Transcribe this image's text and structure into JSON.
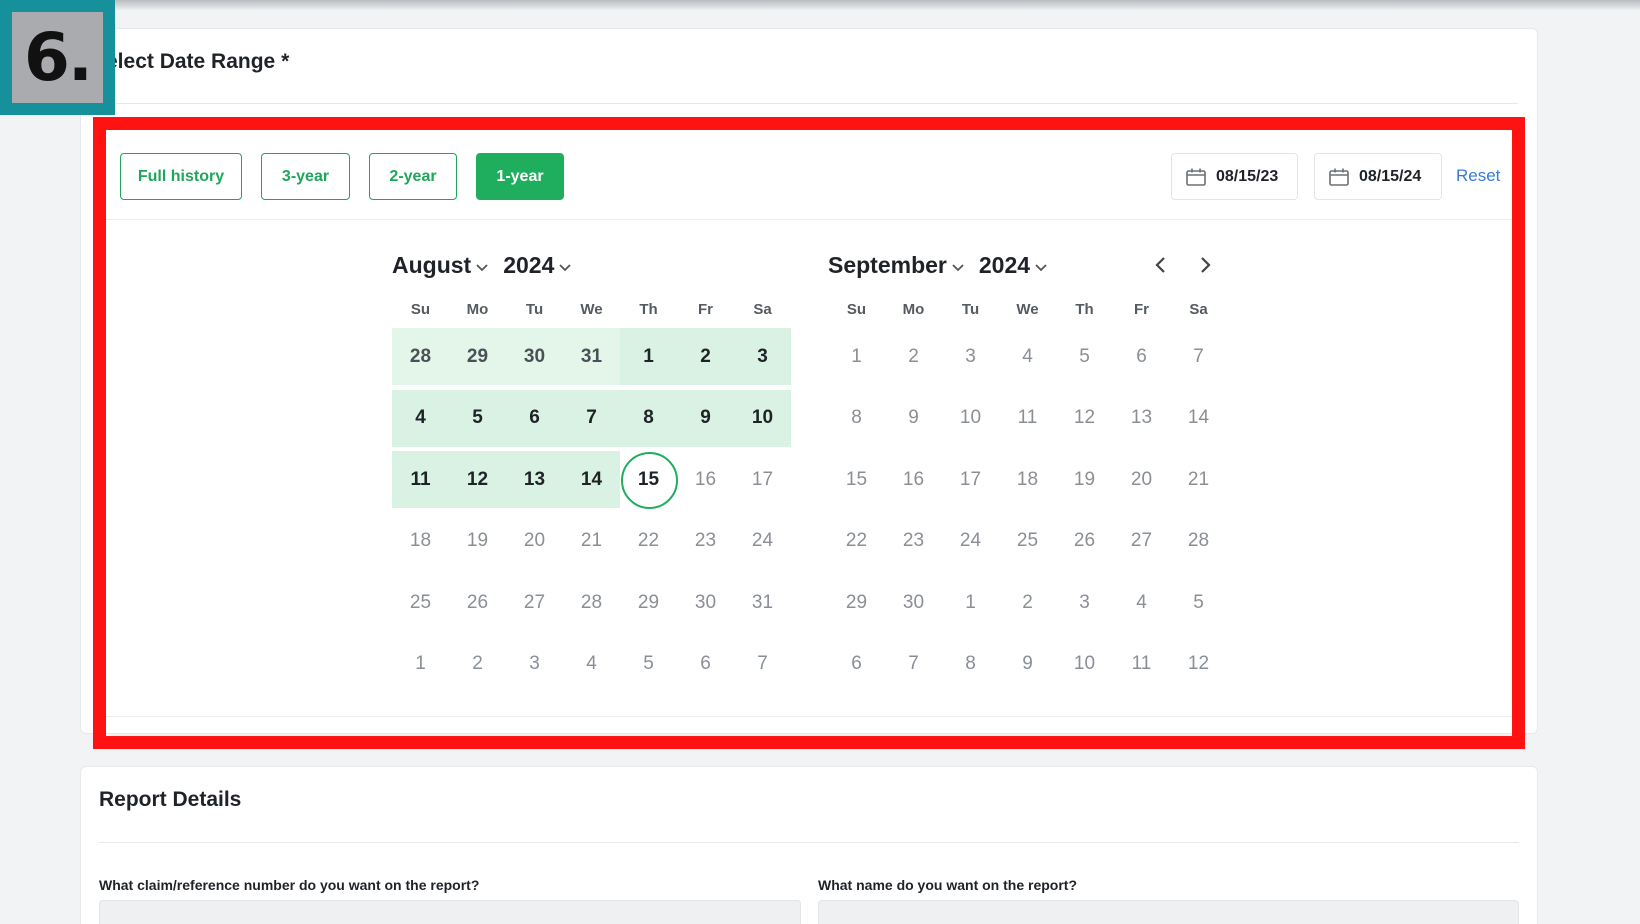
{
  "step_badge": "6.",
  "date_section": {
    "title": "elect Date Range *"
  },
  "range_buttons": [
    {
      "label": "Full history",
      "active": false
    },
    {
      "label": "3-year",
      "active": false
    },
    {
      "label": "2-year",
      "active": false
    },
    {
      "label": "1-year",
      "active": true
    }
  ],
  "start_date": "08/15/23",
  "end_date": "08/15/24",
  "reset_label": "Reset",
  "weekdays": [
    "Su",
    "Mo",
    "Tu",
    "We",
    "Th",
    "Fr",
    "Sa"
  ],
  "calendars": [
    {
      "month": "August",
      "year": "2024",
      "weeks": [
        [
          "28",
          "29",
          "30",
          "31",
          "1",
          "2",
          "3"
        ],
        [
          "4",
          "5",
          "6",
          "7",
          "8",
          "9",
          "10"
        ],
        [
          "11",
          "12",
          "13",
          "14",
          "15",
          "16",
          "17"
        ],
        [
          "18",
          "19",
          "20",
          "21",
          "22",
          "23",
          "24"
        ],
        [
          "25",
          "26",
          "27",
          "28",
          "29",
          "30",
          "31"
        ],
        [
          "1",
          "2",
          "3",
          "4",
          "5",
          "6",
          "7"
        ]
      ]
    },
    {
      "month": "September",
      "year": "2024",
      "weeks": [
        [
          "1",
          "2",
          "3",
          "4",
          "5",
          "6",
          "7"
        ],
        [
          "8",
          "9",
          "10",
          "11",
          "12",
          "13",
          "14"
        ],
        [
          "15",
          "16",
          "17",
          "18",
          "19",
          "20",
          "21"
        ],
        [
          "22",
          "23",
          "24",
          "25",
          "26",
          "27",
          "28"
        ],
        [
          "29",
          "30",
          "1",
          "2",
          "3",
          "4",
          "5"
        ],
        [
          "6",
          "7",
          "8",
          "9",
          "10",
          "11",
          "12"
        ]
      ]
    }
  ],
  "report_section": {
    "title": "Report Details",
    "fields": [
      {
        "label": "What claim/reference number do you want on the report?"
      },
      {
        "label": "What name do you want on the report?"
      }
    ]
  },
  "colors": {
    "accent_green": "#1fae5d",
    "range_fill": "#d9f2e3",
    "highlight_red": "#ff1212",
    "badge_teal": "#16909a",
    "link_blue": "#3a7bd5"
  }
}
